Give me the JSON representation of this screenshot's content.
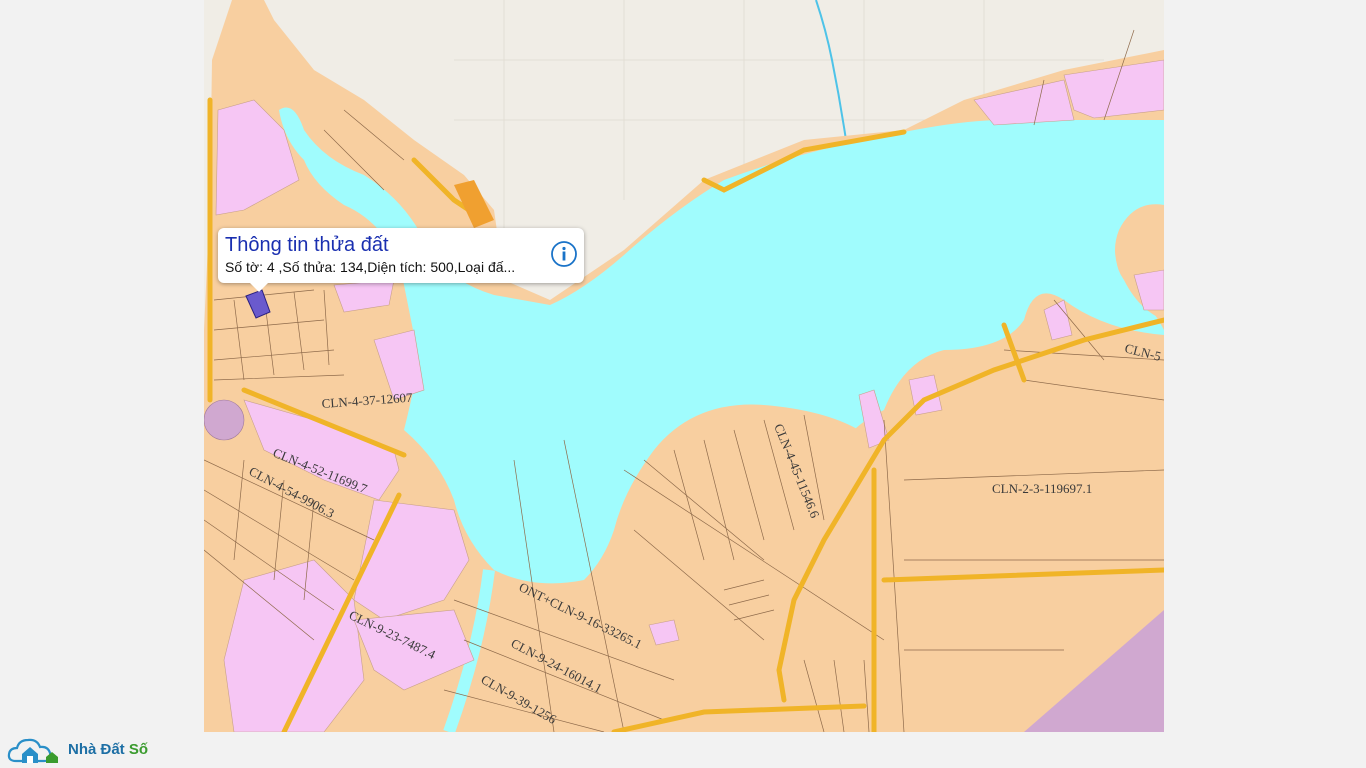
{
  "map": {
    "parcel_labels": [
      "CLN-4-37-12607",
      "CLN-4-52-11699.7",
      "CLN-4-54-9906.3",
      "CLN-9-23-7487.4",
      "ONT+CLN-9-16-33265.1",
      "CLN-9-24-16014.1",
      "CLN-9-39-1256",
      "CLN-4-45-11546.6",
      "CLN-2-3-119697.1",
      "CLN-5"
    ],
    "colors": {
      "water": "#a0fcfd",
      "land_perennial": "#f8cfa0",
      "residential": "#f6c6f4",
      "road": "#f0b428",
      "basemap": "#f0ede6",
      "public_land": "#d0a8d0",
      "selected_parcel": "#6a5acd"
    }
  },
  "callout": {
    "title": "Thông tin thửa đất",
    "details": "Số tờ: 4 ,Số thửa: 134,Diện tích: 500,Loại đấ...",
    "info_icon": "info-circle-icon"
  },
  "brand": {
    "name_part1": "Nhà Đất ",
    "name_part2": "Số",
    "icon": "house-cloud-logo-icon"
  }
}
